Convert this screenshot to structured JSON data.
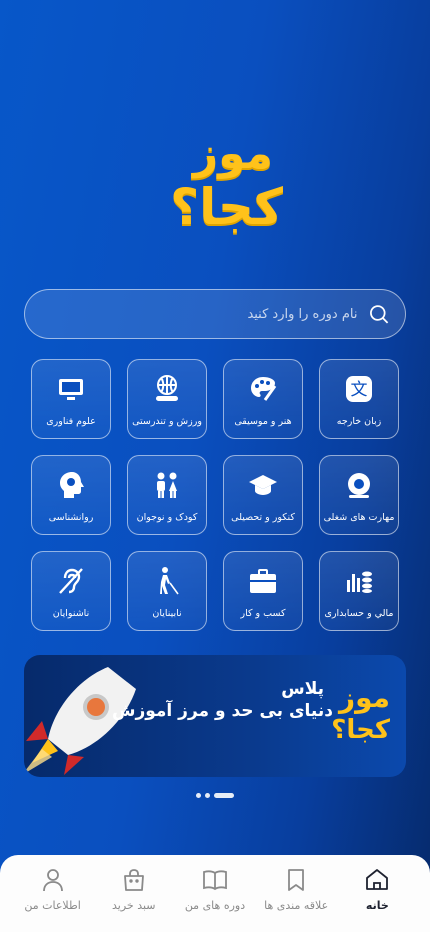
{
  "logo": {
    "line1": "موز",
    "line2": "کجا؟"
  },
  "search": {
    "placeholder": "نام دوره را وارد کنید",
    "icon": "search-icon"
  },
  "categories": [
    {
      "label": "زبان خارجه",
      "icon": "translate-icon"
    },
    {
      "label": "هنر و موسیقی",
      "icon": "palette-icon"
    },
    {
      "label": "ورزش و تندرستی",
      "icon": "sports-icon"
    },
    {
      "label": "علوم فناوری",
      "icon": "monitor-icon"
    },
    {
      "label": "مهارت های شغلی",
      "icon": "gear-skill-icon"
    },
    {
      "label": "کنکور و تحصیلی",
      "icon": "graduation-cap-icon"
    },
    {
      "label": "کودک و نوجوان",
      "icon": "children-icon"
    },
    {
      "label": "روانشناسی",
      "icon": "head-icon"
    },
    {
      "label": "مالي و حسابداری",
      "icon": "finance-icon"
    },
    {
      "label": "کسب و کار",
      "icon": "briefcase-icon"
    },
    {
      "label": "نابینایان",
      "icon": "blind-icon"
    },
    {
      "label": "ناشنوایان",
      "icon": "deaf-icon"
    }
  ],
  "banner": {
    "tagline": "دنیای بی حد و مرز آموزش",
    "logo_line1": "موز",
    "logo_line2": "کجا؟",
    "logo_plus": "پلاس"
  },
  "carousel": {
    "count": 3,
    "active": 2
  },
  "tabbar": [
    {
      "label": "خانه",
      "icon": "home-icon",
      "active": true
    },
    {
      "label": "علاقه مندی ها",
      "icon": "bookmark-icon",
      "active": false
    },
    {
      "label": "دوره های من",
      "icon": "book-icon",
      "active": false
    },
    {
      "label": "سبد خرید",
      "icon": "bag-icon",
      "active": false
    },
    {
      "label": "اطلاعات من",
      "icon": "user-icon",
      "active": false
    }
  ],
  "colors": {
    "accent": "#ffc21a",
    "background": "#0757c9",
    "tab_active": "#1e2230",
    "tab_inactive": "#8a8a8a"
  }
}
